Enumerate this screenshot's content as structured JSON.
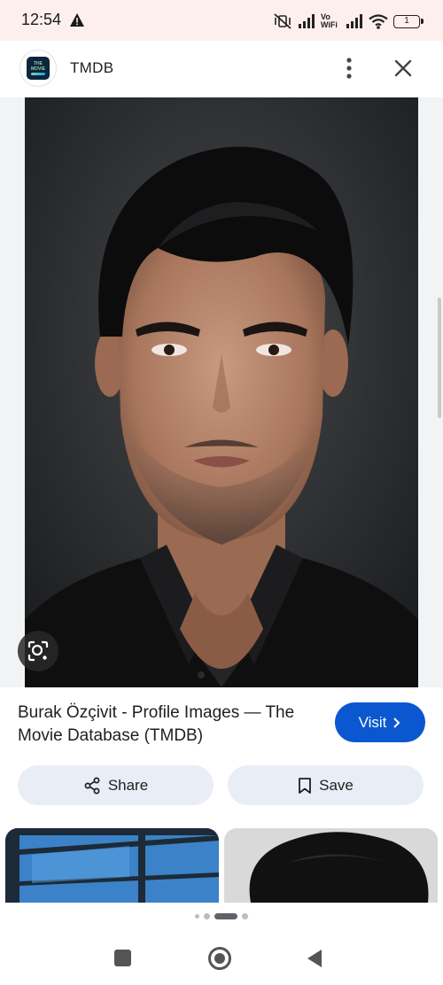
{
  "status_bar": {
    "time": "12:54",
    "network_label": "Vo WiFi",
    "battery_level": "1",
    "icons": [
      "warning-icon",
      "mute-vibrate-icon",
      "signal-icon",
      "signal-icon",
      "wifi-icon",
      "battery-icon"
    ]
  },
  "header": {
    "site_logo_text": [
      "THE",
      "MOVIE",
      "DB"
    ],
    "site_name": "TMDB",
    "icons": [
      "more-vert-icon",
      "close-icon"
    ]
  },
  "result": {
    "title": "Burak Özçivit - Profile Images — The Movie Database (TMDB)",
    "visit_label": "Visit",
    "share_label": "Share",
    "save_label": "Save"
  },
  "pager": {
    "page_count": 5,
    "active_index": 2
  },
  "colors": {
    "status_bar_bg": "#fcefee",
    "visit_button": "#0b57d0",
    "action_button_bg": "#e9eef6",
    "image_area_bg": "#f1f3f4",
    "tmdb_navy": "#0d253f"
  }
}
